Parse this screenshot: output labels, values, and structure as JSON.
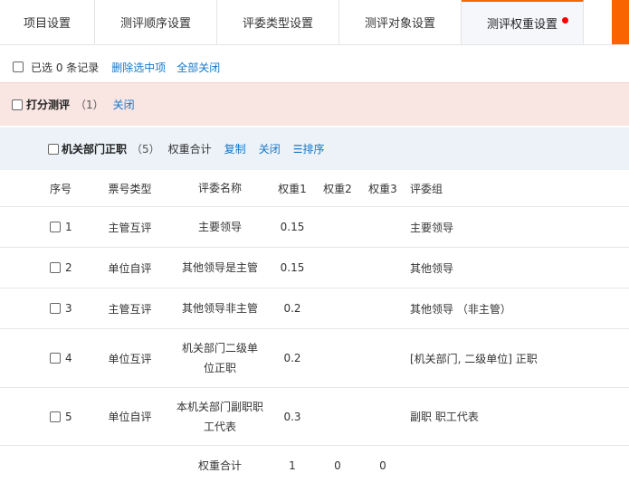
{
  "tabs": [
    {
      "label": "项目设置",
      "active": false
    },
    {
      "label": "测评顺序设置",
      "active": false
    },
    {
      "label": "评委类型设置",
      "active": false
    },
    {
      "label": "测评对象设置",
      "active": false
    },
    {
      "label": "测评权重设置",
      "active": true
    }
  ],
  "toolbar": {
    "selected_text": "已选 0 条记录",
    "delete_label": "删除选中项",
    "close_all_label": "全部关闭"
  },
  "section": {
    "title": "打分测评",
    "count": "（1）",
    "close_label": "关闭"
  },
  "group": {
    "title": "机关部门正职",
    "count": "（5）",
    "total_label": "权重合计",
    "copy_label": "复制",
    "close_label": "关闭",
    "sort_label": "☰排序"
  },
  "table": {
    "headers": {
      "seq": "序号",
      "ticket_type": "票号类型",
      "judge_name": "评委名称",
      "w1": "权重1",
      "w2": "权重2",
      "w3": "权重3",
      "judge_group": "评委组"
    },
    "rows": [
      {
        "seq": "1",
        "ticket_type": "主管互评",
        "judge_name": "主要领导",
        "w1": "0.15",
        "w2": "",
        "w3": "",
        "judge_group": "主要领导"
      },
      {
        "seq": "2",
        "ticket_type": "单位自评",
        "judge_name": "其他领导是主管",
        "w1": "0.15",
        "w2": "",
        "w3": "",
        "judge_group": "其他领导"
      },
      {
        "seq": "3",
        "ticket_type": "主管互评",
        "judge_name": "其他领导非主管",
        "w1": "0.2",
        "w2": "",
        "w3": "",
        "judge_group": "其他领导 （非主管）"
      },
      {
        "seq": "4",
        "ticket_type": "单位互评",
        "judge_name": "机关部门二级单位正职",
        "w1": "0.2",
        "w2": "",
        "w3": "",
        "judge_group": "[机关部门, 二级单位] 正职"
      },
      {
        "seq": "5",
        "ticket_type": "单位自评",
        "judge_name": "本机关部门副职职工代表",
        "w1": "0.3",
        "w2": "",
        "w3": "",
        "judge_group": "副职 职工代表"
      }
    ],
    "footer": {
      "label": "权重合计",
      "w1": "1",
      "w2": "0",
      "w3": "0"
    }
  },
  "colors": {
    "accent": "#f56a00",
    "link": "#1677c9",
    "section_bg": "#f9e5e2",
    "group_bg": "#ecf2f8",
    "badge_dot": "#ff0000"
  }
}
